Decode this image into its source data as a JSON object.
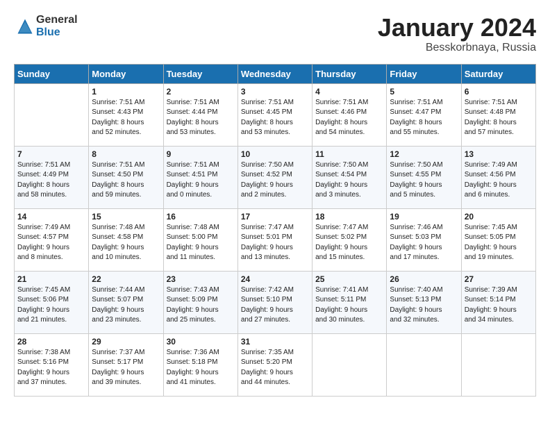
{
  "logo": {
    "general": "General",
    "blue": "Blue"
  },
  "title": "January 2024",
  "location": "Besskorbnaya, Russia",
  "days_of_week": [
    "Sunday",
    "Monday",
    "Tuesday",
    "Wednesday",
    "Thursday",
    "Friday",
    "Saturday"
  ],
  "weeks": [
    [
      {
        "day": "",
        "info": ""
      },
      {
        "day": "1",
        "info": "Sunrise: 7:51 AM\nSunset: 4:43 PM\nDaylight: 8 hours\nand 52 minutes."
      },
      {
        "day": "2",
        "info": "Sunrise: 7:51 AM\nSunset: 4:44 PM\nDaylight: 8 hours\nand 53 minutes."
      },
      {
        "day": "3",
        "info": "Sunrise: 7:51 AM\nSunset: 4:45 PM\nDaylight: 8 hours\nand 53 minutes."
      },
      {
        "day": "4",
        "info": "Sunrise: 7:51 AM\nSunset: 4:46 PM\nDaylight: 8 hours\nand 54 minutes."
      },
      {
        "day": "5",
        "info": "Sunrise: 7:51 AM\nSunset: 4:47 PM\nDaylight: 8 hours\nand 55 minutes."
      },
      {
        "day": "6",
        "info": "Sunrise: 7:51 AM\nSunset: 4:48 PM\nDaylight: 8 hours\nand 57 minutes."
      }
    ],
    [
      {
        "day": "7",
        "info": "Sunrise: 7:51 AM\nSunset: 4:49 PM\nDaylight: 8 hours\nand 58 minutes."
      },
      {
        "day": "8",
        "info": "Sunrise: 7:51 AM\nSunset: 4:50 PM\nDaylight: 8 hours\nand 59 minutes."
      },
      {
        "day": "9",
        "info": "Sunrise: 7:51 AM\nSunset: 4:51 PM\nDaylight: 9 hours\nand 0 minutes."
      },
      {
        "day": "10",
        "info": "Sunrise: 7:50 AM\nSunset: 4:52 PM\nDaylight: 9 hours\nand 2 minutes."
      },
      {
        "day": "11",
        "info": "Sunrise: 7:50 AM\nSunset: 4:54 PM\nDaylight: 9 hours\nand 3 minutes."
      },
      {
        "day": "12",
        "info": "Sunrise: 7:50 AM\nSunset: 4:55 PM\nDaylight: 9 hours\nand 5 minutes."
      },
      {
        "day": "13",
        "info": "Sunrise: 7:49 AM\nSunset: 4:56 PM\nDaylight: 9 hours\nand 6 minutes."
      }
    ],
    [
      {
        "day": "14",
        "info": "Sunrise: 7:49 AM\nSunset: 4:57 PM\nDaylight: 9 hours\nand 8 minutes."
      },
      {
        "day": "15",
        "info": "Sunrise: 7:48 AM\nSunset: 4:58 PM\nDaylight: 9 hours\nand 10 minutes."
      },
      {
        "day": "16",
        "info": "Sunrise: 7:48 AM\nSunset: 5:00 PM\nDaylight: 9 hours\nand 11 minutes."
      },
      {
        "day": "17",
        "info": "Sunrise: 7:47 AM\nSunset: 5:01 PM\nDaylight: 9 hours\nand 13 minutes."
      },
      {
        "day": "18",
        "info": "Sunrise: 7:47 AM\nSunset: 5:02 PM\nDaylight: 9 hours\nand 15 minutes."
      },
      {
        "day": "19",
        "info": "Sunrise: 7:46 AM\nSunset: 5:03 PM\nDaylight: 9 hours\nand 17 minutes."
      },
      {
        "day": "20",
        "info": "Sunrise: 7:45 AM\nSunset: 5:05 PM\nDaylight: 9 hours\nand 19 minutes."
      }
    ],
    [
      {
        "day": "21",
        "info": "Sunrise: 7:45 AM\nSunset: 5:06 PM\nDaylight: 9 hours\nand 21 minutes."
      },
      {
        "day": "22",
        "info": "Sunrise: 7:44 AM\nSunset: 5:07 PM\nDaylight: 9 hours\nand 23 minutes."
      },
      {
        "day": "23",
        "info": "Sunrise: 7:43 AM\nSunset: 5:09 PM\nDaylight: 9 hours\nand 25 minutes."
      },
      {
        "day": "24",
        "info": "Sunrise: 7:42 AM\nSunset: 5:10 PM\nDaylight: 9 hours\nand 27 minutes."
      },
      {
        "day": "25",
        "info": "Sunrise: 7:41 AM\nSunset: 5:11 PM\nDaylight: 9 hours\nand 30 minutes."
      },
      {
        "day": "26",
        "info": "Sunrise: 7:40 AM\nSunset: 5:13 PM\nDaylight: 9 hours\nand 32 minutes."
      },
      {
        "day": "27",
        "info": "Sunrise: 7:39 AM\nSunset: 5:14 PM\nDaylight: 9 hours\nand 34 minutes."
      }
    ],
    [
      {
        "day": "28",
        "info": "Sunrise: 7:38 AM\nSunset: 5:16 PM\nDaylight: 9 hours\nand 37 minutes."
      },
      {
        "day": "29",
        "info": "Sunrise: 7:37 AM\nSunset: 5:17 PM\nDaylight: 9 hours\nand 39 minutes."
      },
      {
        "day": "30",
        "info": "Sunrise: 7:36 AM\nSunset: 5:18 PM\nDaylight: 9 hours\nand 41 minutes."
      },
      {
        "day": "31",
        "info": "Sunrise: 7:35 AM\nSunset: 5:20 PM\nDaylight: 9 hours\nand 44 minutes."
      },
      {
        "day": "",
        "info": ""
      },
      {
        "day": "",
        "info": ""
      },
      {
        "day": "",
        "info": ""
      }
    ]
  ]
}
